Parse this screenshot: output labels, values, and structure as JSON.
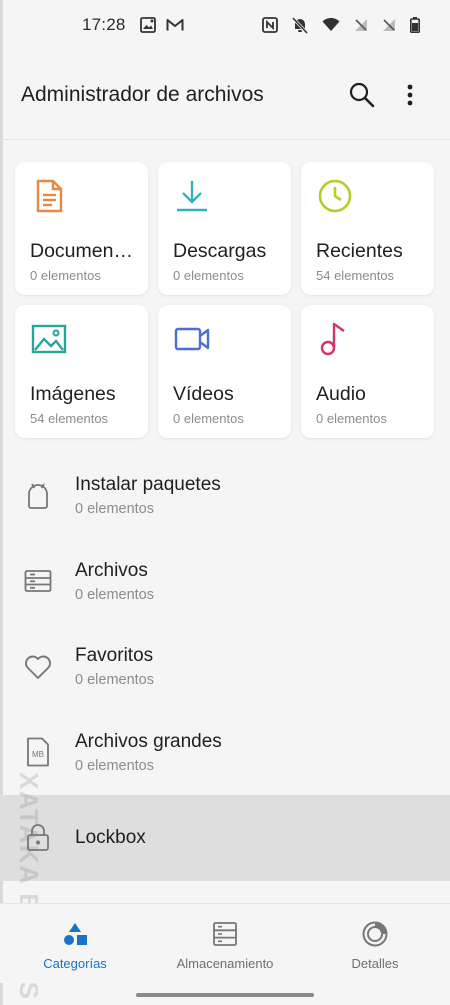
{
  "status_bar": {
    "time": "17:28"
  },
  "app_bar": {
    "title": "Administrador de archivos"
  },
  "categories": [
    {
      "title": "Documen…",
      "subtitle": "0 elementos",
      "icon": "document-icon",
      "color": "#e8893f"
    },
    {
      "title": "Descargas",
      "subtitle": "0 elementos",
      "icon": "download-icon",
      "color": "#2fb5c2"
    },
    {
      "title": "Recientes",
      "subtitle": "54 elementos",
      "icon": "clock-icon",
      "color": "#b5cc2a"
    },
    {
      "title": "Imágenes",
      "subtitle": "54 elementos",
      "icon": "image-icon",
      "color": "#2aa59a"
    },
    {
      "title": "Vídeos",
      "subtitle": "0 elementos",
      "icon": "video-icon",
      "color": "#4a6fd1"
    },
    {
      "title": "Audio",
      "subtitle": "0 elementos",
      "icon": "music-note-icon",
      "color": "#d6326e"
    }
  ],
  "list": [
    {
      "title": "Instalar paquetes",
      "subtitle": "0 elementos",
      "icon": "android-icon"
    },
    {
      "title": "Archivos",
      "subtitle": "0 elementos",
      "icon": "archive-icon"
    },
    {
      "title": "Favoritos",
      "subtitle": "0 elementos",
      "icon": "heart-icon"
    },
    {
      "title": "Archivos grandes",
      "subtitle": "0 elementos",
      "icon": "large-file-icon"
    },
    {
      "title": "Lockbox",
      "subtitle": "",
      "icon": "lock-icon"
    }
  ],
  "bottom_nav": [
    {
      "label": "Categorías",
      "icon": "categories-icon",
      "active": true
    },
    {
      "label": "Almacenamiento",
      "icon": "storage-icon",
      "active": false
    },
    {
      "label": "Detalles",
      "icon": "details-icon",
      "active": false
    }
  ],
  "watermark": {
    "text": "XATAKA BASICS"
  },
  "colors": {
    "accent": "#1a73c9",
    "background": "#f5f5f5",
    "card": "#ffffff",
    "secondary_text": "#8c8c8c"
  }
}
